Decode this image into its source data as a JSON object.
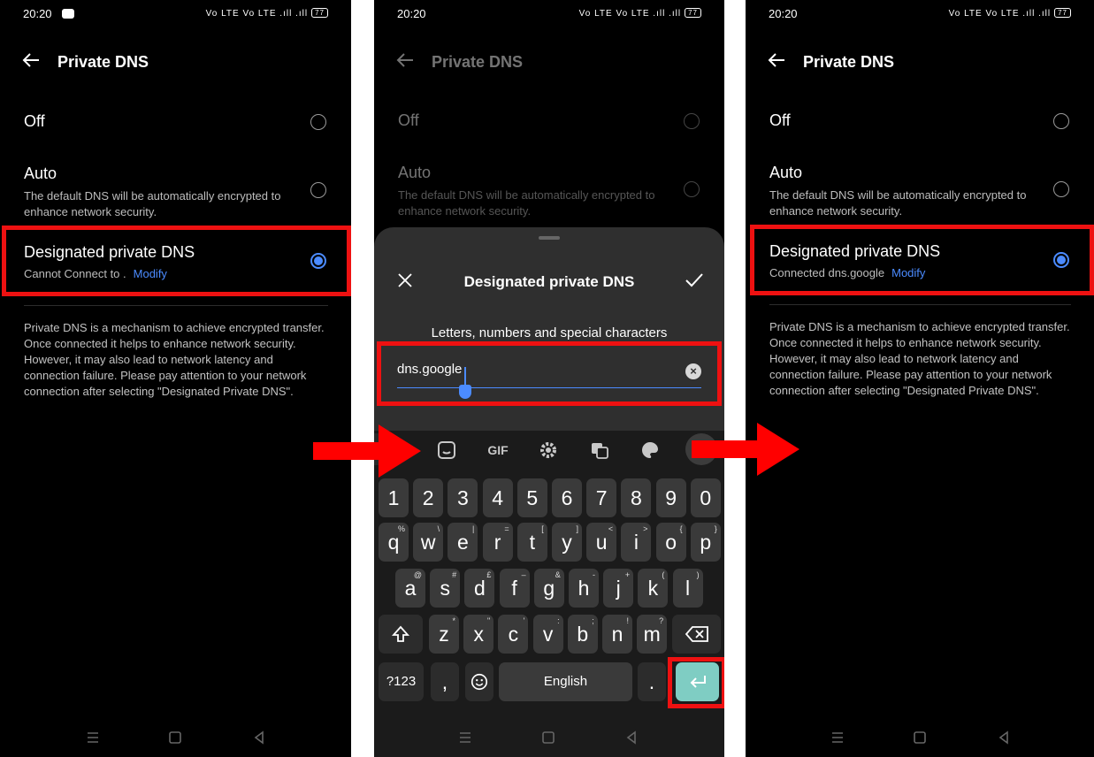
{
  "status": {
    "time": "20:20",
    "signal_text": "Vo LTE  Vo LTE .ıll .ıll",
    "battery": "77"
  },
  "screen_title": "Private DNS",
  "options": {
    "off": {
      "label": "Off"
    },
    "auto": {
      "label": "Auto",
      "description": "The default DNS will be automatically encrypted to enhance network security."
    },
    "designated": {
      "label": "Designated private DNS",
      "status_before": "Cannot Connect to .",
      "status_after": "Connected dns.google",
      "modify": "Modify"
    }
  },
  "info_text": "Private DNS is a mechanism to achieve encrypted transfer. Once connected it helps to enhance network security. However, it may also lead to network latency and connection failure. Please pay attention to your network connection after selecting \"Designated Private DNS\".",
  "dialog": {
    "title": "Designated private DNS",
    "hint": "Letters, numbers and special characters",
    "value": "dns.google"
  },
  "keyboard": {
    "toolbar": {
      "gif": "GIF"
    },
    "numbers": [
      "1",
      "2",
      "3",
      "4",
      "5",
      "6",
      "7",
      "8",
      "9",
      "0"
    ],
    "row1": [
      [
        "q",
        "%"
      ],
      [
        "w",
        "\\"
      ],
      [
        "e",
        "|"
      ],
      [
        "r",
        "="
      ],
      [
        "t",
        "["
      ],
      [
        "y",
        "]"
      ],
      [
        "u",
        "<"
      ],
      [
        "i",
        ">"
      ],
      [
        "o",
        "{"
      ],
      [
        "p",
        "}"
      ]
    ],
    "row2": [
      [
        "a",
        "@"
      ],
      [
        "s",
        "#"
      ],
      [
        "d",
        "£"
      ],
      [
        "f",
        "–"
      ],
      [
        "g",
        "&"
      ],
      [
        "h",
        "-"
      ],
      [
        "j",
        "+"
      ],
      [
        "k",
        "("
      ],
      [
        "l",
        ")"
      ]
    ],
    "row3": [
      [
        "z",
        "*"
      ],
      [
        "x",
        "\""
      ],
      [
        "c",
        "'"
      ],
      [
        "v",
        ":"
      ],
      [
        "b",
        ";"
      ],
      [
        "n",
        "!"
      ],
      [
        "m",
        "?"
      ]
    ],
    "symbols_key": "?123",
    "comma": ",",
    "space": "English",
    "period": "."
  },
  "colors": {
    "accent": "#4b8bff",
    "highlight": "#e11111",
    "enter_key": "#7fcdc3"
  }
}
